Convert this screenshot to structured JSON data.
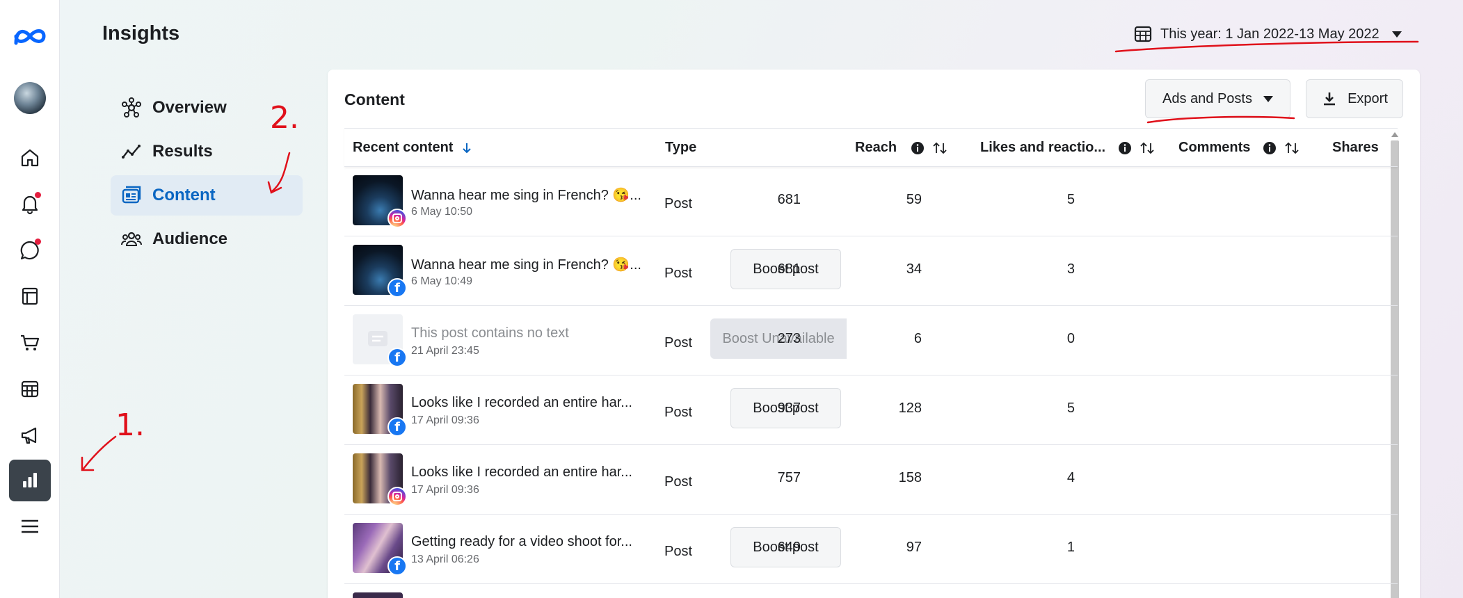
{
  "app": {
    "title": "Insights"
  },
  "rail": {
    "items": [
      {
        "icon": "meta-logo-icon"
      },
      {
        "icon": "avatar"
      },
      {
        "icon": "home-icon"
      },
      {
        "icon": "bell-icon",
        "notify": true
      },
      {
        "icon": "chat-icon",
        "notify": true
      },
      {
        "icon": "pages-icon"
      },
      {
        "icon": "cart-icon"
      },
      {
        "icon": "calendar-grid-icon"
      },
      {
        "icon": "megaphone-icon"
      },
      {
        "icon": "bar-chart-icon",
        "active": true
      },
      {
        "icon": "menu-icon"
      }
    ]
  },
  "nav": {
    "items": [
      {
        "label": "Overview",
        "icon": "network-icon"
      },
      {
        "label": "Results",
        "icon": "trend-line-icon"
      },
      {
        "label": "Content",
        "icon": "content-cards-icon",
        "active": true
      },
      {
        "label": "Audience",
        "icon": "people-icon"
      }
    ]
  },
  "date_range": {
    "label": "This year: 1 Jan 2022-13 May 2022"
  },
  "content": {
    "title": "Content",
    "filter_label": "Ads and Posts",
    "export_label": "Export",
    "columns": {
      "recent": "Recent content",
      "type": "Type",
      "reach": "Reach",
      "likes": "Likes and reactio...",
      "comments": "Comments",
      "shares": "Shares"
    },
    "rows": [
      {
        "text": "Wanna hear me sing in French? 😘...",
        "date": "6 May 10:50",
        "platform": "instagram",
        "type": "Post",
        "action": "",
        "reach": "681",
        "likes": "59",
        "comments": "5",
        "thumb": "space"
      },
      {
        "text": "Wanna hear me sing in French? 😘...",
        "date": "6 May 10:49",
        "platform": "facebook",
        "type": "Post",
        "action": "Boost post",
        "reach": "681",
        "likes": "34",
        "comments": "3",
        "thumb": "space"
      },
      {
        "text": "This post contains no text",
        "date": "21 April 23:45",
        "platform": "facebook",
        "type": "Post",
        "action": "Boost Unavailable",
        "reach": "273",
        "likes": "6",
        "comments": "0",
        "thumb": "placeholder"
      },
      {
        "text": "Looks like I recorded an entire har...",
        "date": "17 April 09:36",
        "platform": "facebook",
        "type": "Post",
        "action": "Boost post",
        "reach": "937",
        "likes": "128",
        "comments": "5",
        "thumb": "harp"
      },
      {
        "text": "Looks like I recorded an entire har...",
        "date": "17 April 09:36",
        "platform": "instagram",
        "type": "Post",
        "action": "",
        "reach": "757",
        "likes": "158",
        "comments": "4",
        "thumb": "harp"
      },
      {
        "text": "Getting ready for a video shoot for...",
        "date": "13 April 06:26",
        "platform": "facebook",
        "type": "Post",
        "action": "Boost post",
        "reach": "649",
        "likes": "97",
        "comments": "1",
        "thumb": "portrait"
      }
    ]
  },
  "annotations": {
    "label_1": "1.",
    "label_2": "2.",
    "color": "#e0101a"
  }
}
